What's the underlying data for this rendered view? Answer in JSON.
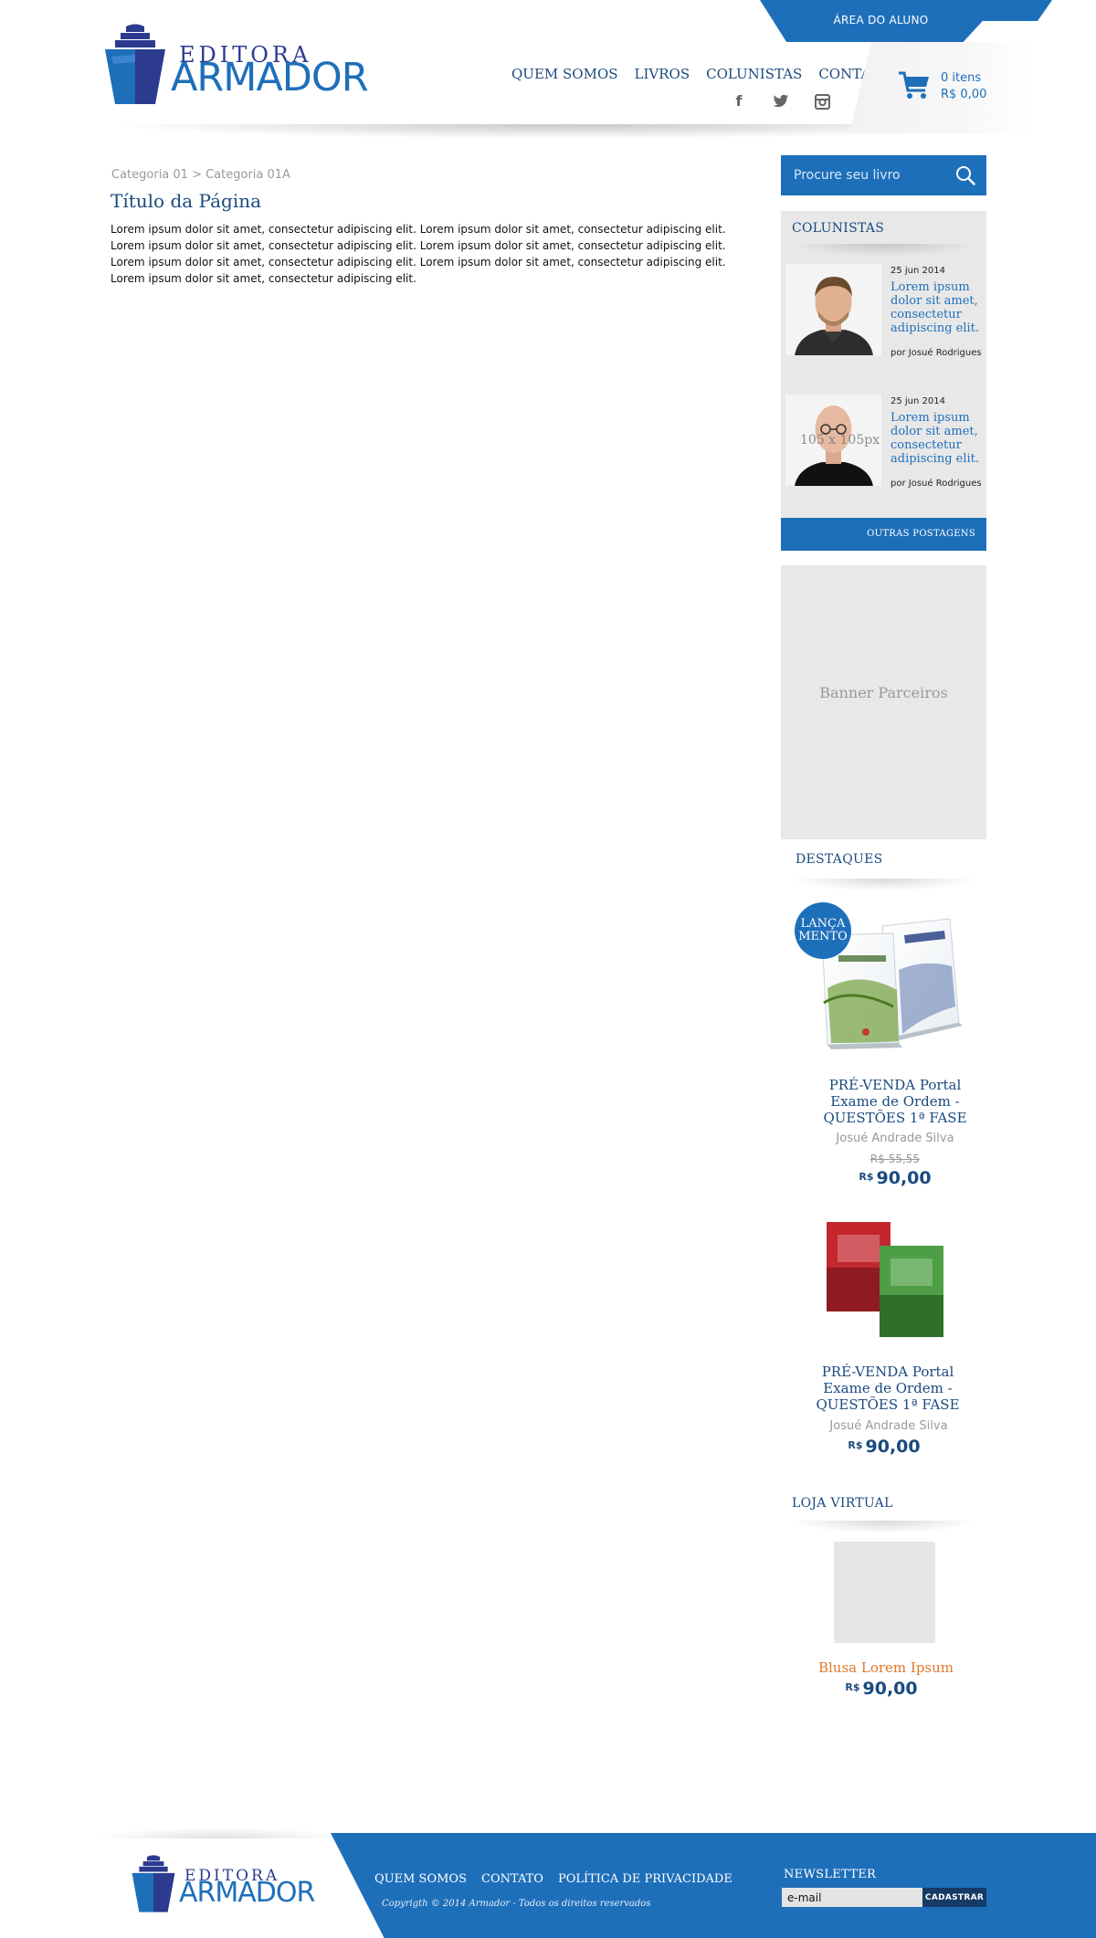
{
  "brand": {
    "logo_line1": "EDITORA",
    "logo_line2": "ARMADOR",
    "primary_color": "#1e6fba",
    "dark_color": "#1a4a7f"
  },
  "header": {
    "area_aluno": "ÁREA DO ALUNO",
    "nav": [
      "QUEM SOMOS",
      "LIVROS",
      "COLUNISTAS",
      "CONTATO"
    ],
    "social_icons": [
      "facebook-icon",
      "twitter-icon",
      "instagram-icon"
    ],
    "cart": {
      "items": "0 itens",
      "total": "R$ 0,00"
    }
  },
  "main": {
    "breadcrumb": "Categoria 01 > Categoria 01A",
    "title": "Título da Página",
    "body": "Lorem ipsum dolor sit amet, consectetur adipiscing elit. Lorem ipsum dolor sit amet, consectetur adipiscing elit. Lorem ipsum dolor sit amet, consectetur adipiscing elit. Lorem ipsum dolor sit amet, consectetur adipiscing elit. Lorem ipsum dolor sit amet, consectetur adipiscing elit. Lorem ipsum dolor sit amet, consectetur adipiscing elit. Lorem ipsum dolor sit amet, consectetur adipiscing elit."
  },
  "sidebar": {
    "search_placeholder": "Procure seu livro",
    "colunistas": {
      "title": "COLUNISTAS",
      "posts": [
        {
          "date": "25 jun 2014",
          "title": "Lorem ipsum dolor sit amet, consectetur adipiscing elit.",
          "author": "por Josué Rodrigues"
        },
        {
          "date": "25 jun 2014",
          "title": "Lorem ipsum dolor sit amet, consectetur adipiscing elit.",
          "author": "por Josué Rodrigues",
          "photo_placeholder": "105 x 105px"
        }
      ],
      "more": "OUTRAS POSTAGENS"
    },
    "banner": "Banner Parceiros",
    "destaques": {
      "title": "DESTAQUES",
      "badge": "LANÇA MENTO",
      "books": [
        {
          "title": "PRÉ-VENDA Portal Exame de Ordem - QUESTÕES 1ª FASE",
          "author": "Josué Andrade Silva",
          "old_price": "R$ 55,55",
          "currency": "R$",
          "price": "90,00"
        },
        {
          "title": "PRÉ-VENDA Portal Exame de Ordem - QUESTÕES 1ª FASE",
          "author": "Josué Andrade Silva",
          "currency": "R$",
          "price": "90,00"
        }
      ]
    },
    "loja": {
      "title": "LOJA VIRTUAL",
      "product": {
        "name": "Blusa Lorem Ipsum",
        "currency": "R$",
        "price": "90,00",
        "name_color": "#e0782b"
      }
    }
  },
  "footer": {
    "logo_line1": "EDITORA",
    "logo_line2": "ARMADOR",
    "nav": [
      "QUEM SOMOS",
      "CONTATO",
      "POLÍTICA DE PRIVACIDADE"
    ],
    "copyright": "Copyrigth © 2014 Armador - Todos os direitos reservados",
    "newsletter_title": "NEWSLETTER",
    "newsletter_placeholder": "e-mail",
    "newsletter_button": "CADASTRAR"
  }
}
